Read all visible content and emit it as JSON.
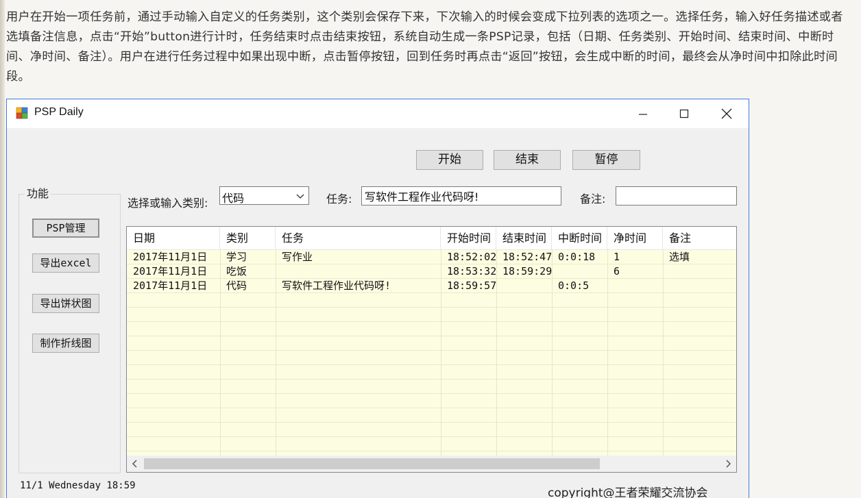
{
  "intro_text": "用户在开始一项任务前，通过手动输入自定义的任务类别，这个类别会保存下来，下次输入的时候会变成下拉列表的选项之一。选择任务，输入好任务描述或者选填备注信息，点击“开始”button进行计时，任务结束时点击结束按钮，系统自动生成一条PSP记录，包括（日期、任务类别、开始时间、结束时间、中断时间、净时间、备注）。用户在进行任务过程中如果出现中断，点击暂停按钮，回到任务时再点击“返回”按钮，会生成中断的时间，最终会从净时间中扣除此时间段。",
  "window": {
    "title": "PSP Daily",
    "icons": {
      "app": "app-icon",
      "minimize": "minimize-icon",
      "maximize": "maximize-icon",
      "close": "close-icon"
    }
  },
  "toolbar": {
    "start_label": "开始",
    "end_label": "结束",
    "pause_label": "暂停"
  },
  "sidebar": {
    "title": "功能",
    "buttons": [
      {
        "label": "PSP管理"
      },
      {
        "label": "导出excel"
      },
      {
        "label": "导出饼状图"
      },
      {
        "label": "制作折线图"
      }
    ]
  },
  "form": {
    "category_label": "选择或输入类别:",
    "category_value": "代码",
    "task_label": "任务:",
    "task_value": "写软件工程作业代码呀!",
    "note_label": "备注:",
    "note_value": ""
  },
  "grid": {
    "columns": [
      "日期",
      "类别",
      "任务",
      "开始时间",
      "结束时间",
      "中断时间",
      "净时间",
      "备注"
    ],
    "rows": [
      [
        "2017年11月1日",
        "学习",
        "写作业",
        "18:52:02",
        "18:52:47",
        "0:0:18",
        "1",
        "选填"
      ],
      [
        "2017年11月1日",
        "吃饭",
        "",
        "18:53:32",
        "18:59:29",
        "",
        "6",
        ""
      ],
      [
        "2017年11月1日",
        "代码",
        "写软件工程作业代码呀!",
        "18:59:57",
        "",
        "0:0:5",
        "",
        ""
      ]
    ]
  },
  "status": {
    "datetime": "11/1  Wednesday 18:59"
  },
  "copyright": "copyright@王者荣耀交流协会"
}
